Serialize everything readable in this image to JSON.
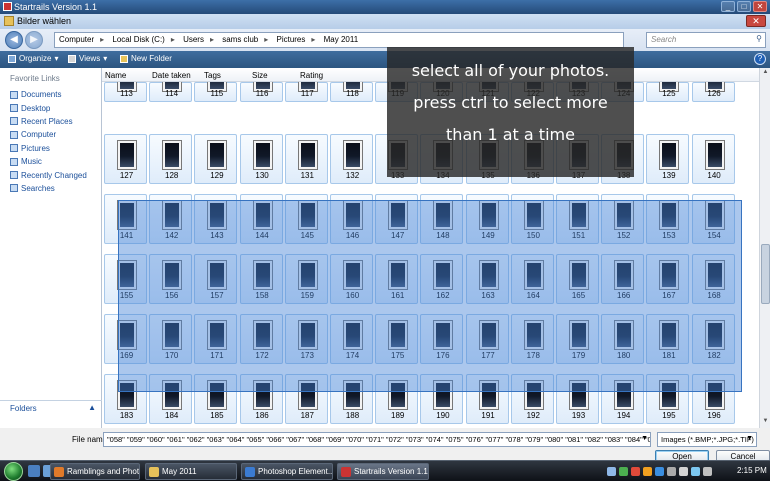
{
  "app_window": {
    "title": "Startrails Version 1.1"
  },
  "dialog": {
    "title": "Bilder wählen",
    "address": [
      "Computer",
      "Local Disk (C:)",
      "Users",
      "sams club",
      "Pictures",
      "May 2011"
    ],
    "search_placeholder": "Search",
    "toolbar": {
      "organize": "Organize",
      "views": "Views",
      "new_folder": "New Folder"
    },
    "favorites_header": "Favorite Links",
    "favorites": [
      "Documents",
      "Desktop",
      "Recent Places",
      "Computer",
      "Pictures",
      "Music",
      "Recently Changed",
      "Searches"
    ],
    "folders_label": "Folders",
    "columns": [
      "Name",
      "Date taken",
      "Tags",
      "Size",
      "Rating"
    ],
    "file_rows": [
      [
        "113",
        "114",
        "115",
        "116",
        "117",
        "118",
        "119",
        "120",
        "121",
        "122",
        "123",
        "124",
        "125",
        "126"
      ],
      [
        "127",
        "128",
        "129",
        "130",
        "131",
        "132",
        "133",
        "134",
        "135",
        "136",
        "137",
        "138",
        "139",
        "140"
      ],
      [
        "141",
        "142",
        "143",
        "144",
        "145",
        "146",
        "147",
        "148",
        "149",
        "150",
        "151",
        "152",
        "153",
        "154"
      ],
      [
        "155",
        "156",
        "157",
        "158",
        "159",
        "160",
        "161",
        "162",
        "163",
        "164",
        "165",
        "166",
        "167",
        "168"
      ],
      [
        "169",
        "170",
        "171",
        "172",
        "173",
        "174",
        "175",
        "176",
        "177",
        "178",
        "179",
        "180",
        "181",
        "182"
      ],
      [
        "183",
        "184",
        "185",
        "186",
        "187",
        "188",
        "189",
        "190",
        "191",
        "192",
        "193",
        "194",
        "195",
        "196"
      ]
    ],
    "file_name_label": "File name:",
    "file_name_value": "\"058\" \"059\" \"060\" \"061\" \"062\" \"063\" \"064\" \"065\" \"066\" \"067\" \"068\" \"069\" \"070\" \"071\" \"072\" \"073\" \"074\" \"075\" \"076\" \"077\" \"078\" \"079\" \"080\" \"081\" \"082\" \"083\" \"084\" \"085\" \"086\"",
    "file_type": "Images (*.BMP;*.JPG;*.TIF)",
    "open_label": "Open",
    "cancel_label": "Cancel"
  },
  "overlay_note": [
    "select all of your photos.",
    "press ctrl   to select more",
    "than 1 at a time"
  ],
  "taskbar": {
    "tasks": [
      "Ramblings and Phot...",
      "May 2011",
      "Photoshop Element...",
      "Startrails Version 1.1"
    ],
    "clock": "2:15 PM"
  },
  "colors": {
    "accent": "#3773c0",
    "selection": "#4483d6",
    "titlebar": "#2c5580"
  }
}
